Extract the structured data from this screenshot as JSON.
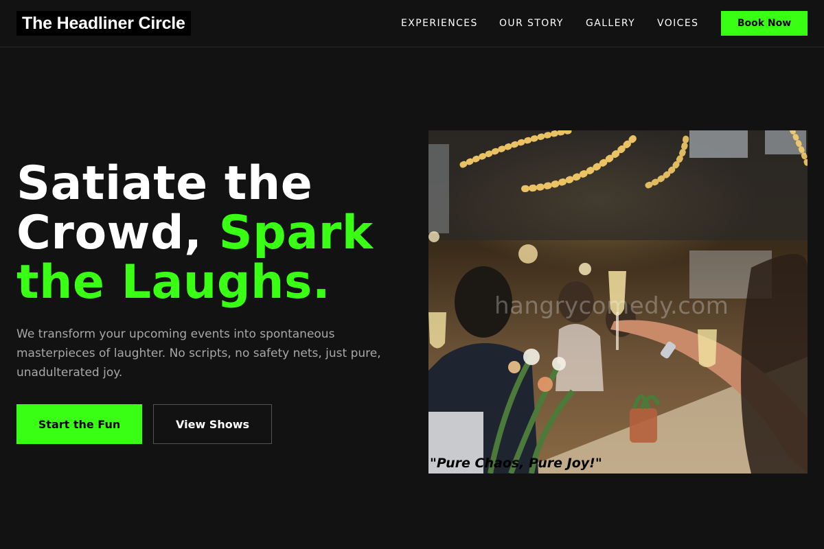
{
  "brand": {
    "name": "The Headliner Circle"
  },
  "nav": {
    "items": [
      {
        "label": "EXPERIENCES"
      },
      {
        "label": "OUR STORY"
      },
      {
        "label": "GALLERY"
      },
      {
        "label": "VOICES"
      }
    ],
    "cta_label": "Book Now"
  },
  "hero": {
    "title_line1": "Satiate the",
    "title_line2": "Crowd, ",
    "title_accent1": "Spark",
    "title_accent2": "the Laughs.",
    "subtitle": "We transform your upcoming events into spontaneous masterpieces of laughter. No scripts, no safety nets, just pure, unadulterated joy.",
    "primary_cta": "Start the Fun",
    "secondary_cta": "View Shows"
  },
  "photo": {
    "watermark": "hangrycomedy.com",
    "caption": "\"Pure Chaos, Pure Joy!\""
  },
  "colors": {
    "background": "#121212",
    "accent": "#39ff14",
    "text": "#ffffff",
    "muted": "#a8a8a8"
  }
}
